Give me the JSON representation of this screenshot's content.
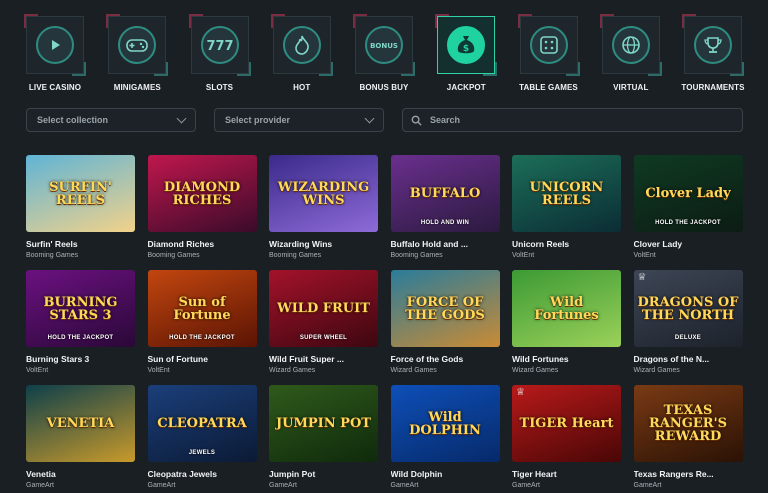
{
  "categories": [
    {
      "label": "LIVE CASINO",
      "icon": "play-icon",
      "active": false
    },
    {
      "label": "MINIGAMES",
      "icon": "gamepad-icon",
      "active": false
    },
    {
      "label": "SLOTS",
      "icon": "slots-777-icon",
      "active": false
    },
    {
      "label": "HOT",
      "icon": "flame-icon",
      "active": false
    },
    {
      "label": "BONUS BUY",
      "icon": "bonus-icon",
      "active": false,
      "badge": "BONUS"
    },
    {
      "label": "JACKPOT",
      "icon": "money-bag-icon",
      "active": true
    },
    {
      "label": "TABLE GAMES",
      "icon": "dice-icon",
      "active": false
    },
    {
      "label": "VIRTUAL",
      "icon": "globe-icon",
      "active": false
    },
    {
      "label": "TOURNAMENTS",
      "icon": "trophy-icon",
      "active": false
    }
  ],
  "filters": {
    "collection_placeholder": "Select collection",
    "provider_placeholder": "Select provider",
    "search_placeholder": "Search"
  },
  "games": [
    {
      "name": "Surfin' Reels",
      "provider": "Booming Games",
      "art": "SURFIN' REELS",
      "sub": "",
      "bg": "#5fb4d6",
      "bg2": "#f2d28a"
    },
    {
      "name": "Diamond Riches",
      "provider": "Booming Games",
      "art": "DIAMOND RICHES",
      "sub": "",
      "bg": "#c0174d",
      "bg2": "#3a0b2a"
    },
    {
      "name": "Wizarding Wins",
      "provider": "Booming Games",
      "art": "WIZARDING WINS",
      "sub": "",
      "bg": "#3a2a8a",
      "bg2": "#8e6bd8"
    },
    {
      "name": "Buffalo Hold and ...",
      "provider": "Booming Games",
      "art": "BUFFALO",
      "sub": "HOLD AND WIN",
      "bg": "#6a2f8e",
      "bg2": "#2b1a3f"
    },
    {
      "name": "Unicorn Reels",
      "provider": "VoltEnt",
      "art": "UNICORN REELS",
      "sub": "",
      "bg": "#1c6e58",
      "bg2": "#0b2d35"
    },
    {
      "name": "Clover Lady",
      "provider": "VoltEnt",
      "art": "Clover Lady",
      "sub": "HOLD THE JACKPOT",
      "bg": "#0f3a22",
      "bg2": "#0c1c14"
    },
    {
      "name": "Burning Stars 3",
      "provider": "VoltEnt",
      "art": "BURNING STARS 3",
      "sub": "HOLD THE JACKPOT",
      "bg": "#6b1180",
      "bg2": "#2a0838"
    },
    {
      "name": "Sun of Fortune",
      "provider": "VoltEnt",
      "art": "Sun of Fortune",
      "sub": "HOLD THE JACKPOT",
      "bg": "#c2460f",
      "bg2": "#5b1404"
    },
    {
      "name": "Wild Fruit Super ...",
      "provider": "Wizard Games",
      "art": "WILD FRUIT",
      "sub": "SUPER WHEEL",
      "bg": "#a3122a",
      "bg2": "#3d0710"
    },
    {
      "name": "Force of the Gods",
      "provider": "Wizard Games",
      "art": "FORCE OF THE GODS",
      "sub": "",
      "bg": "#2a7c9a",
      "bg2": "#c98b35"
    },
    {
      "name": "Wild Fortunes",
      "provider": "Wizard Games",
      "art": "Wild Fortunes",
      "sub": "",
      "bg": "#3c9a34",
      "bg2": "#9bd15a"
    },
    {
      "name": "Dragons of the N...",
      "provider": "Wizard Games",
      "art": "DRAGONS OF THE NORTH",
      "sub": "DELUXE",
      "bg": "#3d4656",
      "bg2": "#1d222b",
      "trophy": true
    },
    {
      "name": "Venetia",
      "provider": "GameArt",
      "art": "VENETIA",
      "sub": "",
      "bg": "#0d3f4a",
      "bg2": "#c99a2b"
    },
    {
      "name": "Cleopatra Jewels",
      "provider": "GameArt",
      "art": "CLEOPATRA",
      "sub": "JEWELS",
      "bg": "#1b3f7a",
      "bg2": "#0b1a35"
    },
    {
      "name": "Jumpin Pot",
      "provider": "GameArt",
      "art": "JUMPIN POT",
      "sub": "",
      "bg": "#2f5a1b",
      "bg2": "#0f2a0c"
    },
    {
      "name": "Wild Dolphin",
      "provider": "GameArt",
      "art": "Wild DOLPHIN",
      "sub": "",
      "bg": "#0e4fb8",
      "bg2": "#062a6a"
    },
    {
      "name": "Tiger Heart",
      "provider": "GameArt",
      "art": "TIGER Heart",
      "sub": "",
      "bg": "#b81a1a",
      "bg2": "#4a0606",
      "trophy": true
    },
    {
      "name": "Texas Rangers Re...",
      "provider": "GameArt",
      "art": "TEXAS RANGER'S REWARD",
      "sub": "",
      "bg": "#7a3a14",
      "bg2": "#2a1205"
    }
  ]
}
